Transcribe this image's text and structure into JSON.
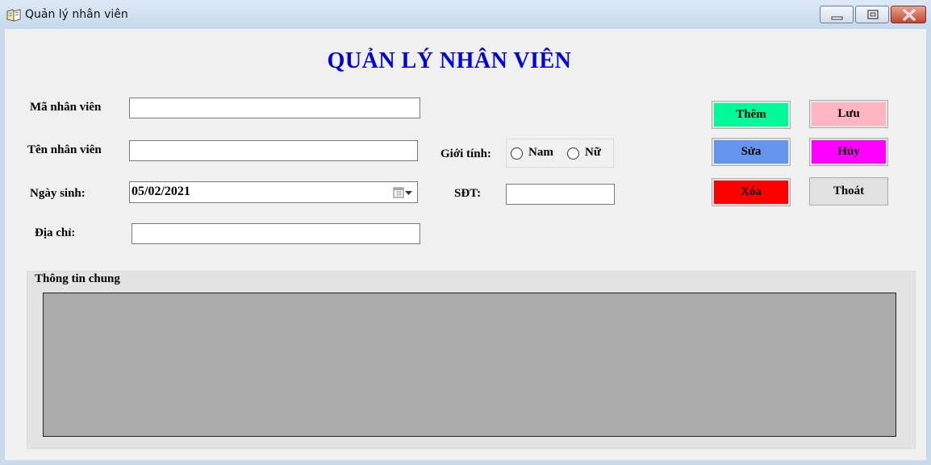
{
  "window": {
    "title": "Quản lý nhân viên",
    "controls": [
      "minimize-icon",
      "maximize-icon",
      "close-icon"
    ]
  },
  "form": {
    "heading": "QUẢN LÝ NHÂN VIÊN",
    "heading_color": "#0000d8",
    "fields": {
      "employee_id": {
        "label": "Mã nhân viên",
        "value": ""
      },
      "employee_name": {
        "label": "Tên nhân viên",
        "value": ""
      },
      "birth_date": {
        "label": "Ngày sinh:",
        "value": "05/02/2021",
        "icon": "calendar-dropdown-icon"
      },
      "address": {
        "label": "Địa chỉ:",
        "value": ""
      },
      "gender": {
        "label": "Giới tính:",
        "options": [
          "Nam",
          "Nữ"
        ],
        "selected": null
      },
      "phone": {
        "label": "SĐT:",
        "value": ""
      }
    }
  },
  "buttons": {
    "add": {
      "label": "Thêm",
      "color": "#00fa9a"
    },
    "save": {
      "label": "Lưu",
      "color": "#ffb6c1"
    },
    "edit": {
      "label": "Sửa",
      "color": "#6495ed"
    },
    "cancel": {
      "label": "Hủy",
      "color": "#ff00ff"
    },
    "delete": {
      "label": "Xóa",
      "color": "#ff0000"
    },
    "exit": {
      "label": "Thoát",
      "color": "#e1e1e1"
    }
  },
  "group": {
    "caption": "Thông tin chung",
    "grid_color": "#ababab"
  }
}
